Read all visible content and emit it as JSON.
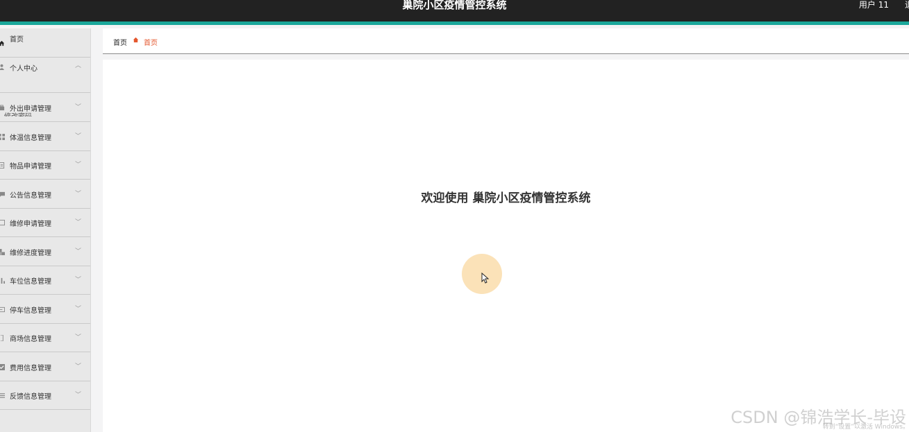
{
  "header": {
    "title": "巢院小区疫情管控系统",
    "user": "用户 11",
    "logout": "退"
  },
  "sidebar": {
    "items": [
      {
        "label": "首页",
        "icon": "home-icon",
        "chevron": ""
      },
      {
        "label": "个人中心",
        "icon": "user-icon",
        "chevron": "^"
      },
      {
        "label": "外出申请管理",
        "icon": "bag-icon",
        "chevron": "v"
      },
      {
        "label": "体温信息管理",
        "icon": "grid-icon",
        "chevron": "v"
      },
      {
        "label": "物品申请管理",
        "icon": "document-icon",
        "chevron": "v"
      },
      {
        "label": "公告信息管理",
        "icon": "chat-icon",
        "chevron": "v"
      },
      {
        "label": "维修申请管理",
        "icon": "square-icon",
        "chevron": "v"
      },
      {
        "label": "维修进度管理",
        "icon": "puzzle-icon",
        "chevron": "v"
      },
      {
        "label": "车位信息管理",
        "icon": "chart-icon",
        "chevron": "v"
      },
      {
        "label": "停车信息管理",
        "icon": "card-icon",
        "chevron": "v"
      },
      {
        "label": "商场信息管理",
        "icon": "bracket-icon",
        "chevron": "v"
      },
      {
        "label": "费用信息管理",
        "icon": "check-icon",
        "chevron": "v"
      },
      {
        "label": "反馈信息管理",
        "icon": "list-icon",
        "chevron": "v"
      }
    ],
    "subitem": "修改密码"
  },
  "breadcrumb": {
    "home": "首页",
    "current": "首页"
  },
  "main": {
    "welcome": "欢迎使用 巢院小区疫情管控系统"
  },
  "watermark": "CSDN @锦浩学长-毕设",
  "activate_text": "转到“设置”以激活 Windows。",
  "colors": {
    "header_bg": "#222222",
    "accent_bar": "#1aa79a",
    "crumb_active": "#e4572e"
  }
}
